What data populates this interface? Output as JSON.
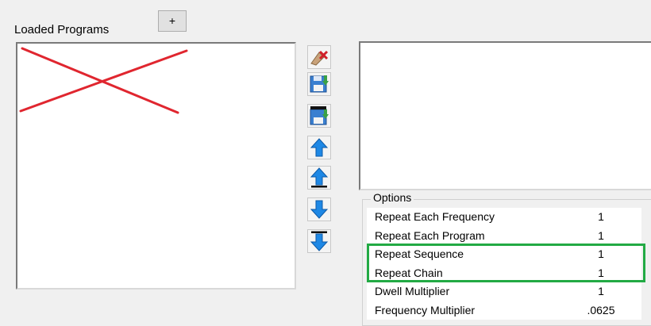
{
  "header": {
    "loaded_programs_label": "Loaded Programs",
    "add_button_label": "+"
  },
  "program_list": {
    "items": [],
    "overlay": "red-x-mark"
  },
  "toolbar": {
    "buttons": [
      {
        "name": "delete-program-icon"
      },
      {
        "name": "save-icon"
      },
      {
        "name": "save-chain-icon"
      },
      {
        "name": "move-up-icon"
      },
      {
        "name": "move-top-icon"
      },
      {
        "name": "move-down-icon"
      },
      {
        "name": "move-bottom-icon"
      }
    ]
  },
  "options": {
    "title": "Options",
    "rows": [
      {
        "label": "Repeat Each Frequency",
        "value": "1"
      },
      {
        "label": "Repeat Each Program",
        "value": "1"
      },
      {
        "label": "Repeat Sequence",
        "value": "1"
      },
      {
        "label": "Repeat Chain",
        "value": "1"
      },
      {
        "label": "Dwell Multiplier",
        "value": "1"
      },
      {
        "label": "Frequency Multiplier",
        "value": ".0625"
      }
    ],
    "highlight_color": "#22aa44"
  },
  "colors": {
    "annotation_red": "#e0262f",
    "highlight_green": "#22aa44",
    "arrow_blue": "#1e88e5"
  }
}
